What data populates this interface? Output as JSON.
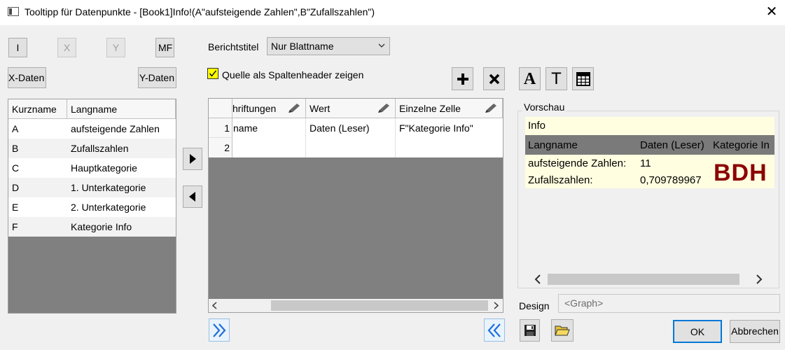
{
  "window": {
    "title": "Tooltipp für Datenpunkte - [Book1]Info!(A\"aufsteigende Zahlen\",B\"Zufallszahlen\")",
    "close_glyph": "✕"
  },
  "toolbar_left": {
    "i_label": "I",
    "x_label": "X",
    "y_label": "Y",
    "mf_label": "MF",
    "x_data_label": "X-Daten",
    "y_data_label": "Y-Daten"
  },
  "report": {
    "title_label": "Berichtstitel",
    "title_value": "Nur Blattname",
    "show_source_label": "Quelle als Spaltenheader zeigen",
    "show_source_checked": true
  },
  "left_table": {
    "columns": [
      "Kurzname",
      "Langname"
    ],
    "rows": [
      [
        "A",
        "aufsteigende Zahlen"
      ],
      [
        "B",
        "Zufallszahlen"
      ],
      [
        "C",
        "Hauptkategorie"
      ],
      [
        "D",
        "1. Unterkategorie"
      ],
      [
        "E",
        "2. Unterkategorie"
      ],
      [
        "F",
        "Kategorie Info"
      ]
    ]
  },
  "middle_table": {
    "columns": [
      "hriftungen",
      "Wert",
      "Einzelne Zelle"
    ],
    "row_numbers": [
      "1",
      "2"
    ],
    "rows": [
      [
        "name",
        "Daten (Leser)",
        "F\"Kategorie Info\""
      ],
      [
        "",
        "",
        ""
      ]
    ]
  },
  "preview": {
    "group_label": "Vorschau",
    "info": "Info",
    "headers": [
      "Langname",
      "Daten (Leser)",
      "Kategorie In"
    ],
    "rows": [
      [
        "aufsteigende Zahlen:",
        "11"
      ],
      [
        "Zufallszahlen:",
        "0,709789967"
      ]
    ],
    "logo_text": "BDH"
  },
  "design": {
    "label": "Design",
    "placeholder": "<Graph>"
  },
  "buttons": {
    "ok": "OK",
    "cancel": "Abbrechen"
  },
  "icons": {
    "add": "plus-icon",
    "delete": "x-icon",
    "font": "font-icon",
    "text": "text-icon",
    "table": "table-icon",
    "save": "save-icon",
    "open": "open-folder-icon"
  },
  "colors": {
    "grid_empty": "#808080",
    "highlight_yellow": "#ffff00",
    "preview_bg": "#fffee0",
    "logo": "#8b0000",
    "accent_blue": "#1e6fd9"
  }
}
